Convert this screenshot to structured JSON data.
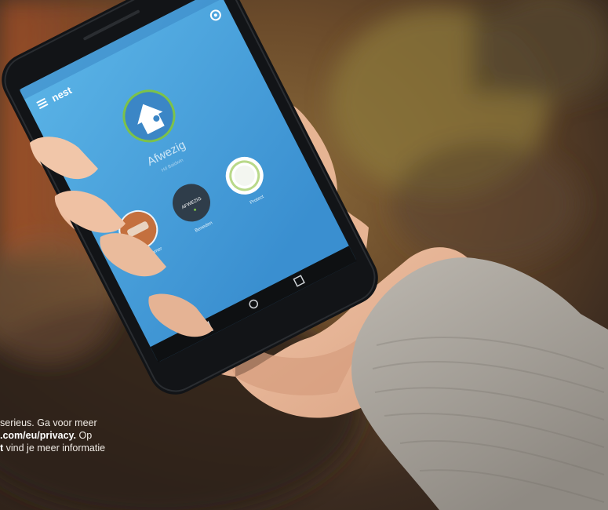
{
  "app": {
    "brand": "nest",
    "home_mode": "Afwezig",
    "home_mode_sub": "Hd Baldwin",
    "devices": [
      {
        "label": "Woonkamer"
      },
      {
        "label": "Beneden",
        "badge": "AFWEZIG"
      },
      {
        "label": "Protect"
      }
    ]
  },
  "caption": {
    "line1": "serieus. Ga voor meer",
    "line2_bold": ".com/eu/privacy.",
    "line2_rest": " Op",
    "line3_bold": "t",
    "line3_rest": " vind je meer informatie"
  },
  "colors": {
    "screen_top": "#4fa8e0",
    "screen_bottom": "#3c92d3",
    "accent_green": "#7cc24a",
    "phone_body": "#17191c",
    "sleeve": "#a8a39b"
  },
  "icons": [
    "menu-icon",
    "settings-icon",
    "home-icon",
    "back-icon",
    "home-nav-icon",
    "recents-icon"
  ]
}
